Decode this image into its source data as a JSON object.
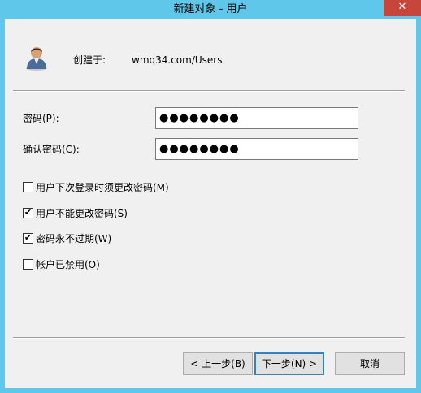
{
  "window": {
    "title": "新建对象 - 用户",
    "close_glyph": "✕"
  },
  "header": {
    "icon": "user-icon",
    "created_in_label": "创建于:",
    "created_in_value": "wmq34.com/Users"
  },
  "fields": {
    "password_label": "密码(P):",
    "password_value": "●●●●●●●●",
    "confirm_label": "确认密码(C):",
    "confirm_value": "●●●●●●●●"
  },
  "options": [
    {
      "label": "用户下次登录时须更改密码(M)",
      "checked": false,
      "mark": ""
    },
    {
      "label": "用户不能更改密码(S)",
      "checked": true,
      "mark": "✔"
    },
    {
      "label": "密码永不过期(W)",
      "checked": true,
      "mark": "✔"
    },
    {
      "label": "帐户已禁用(O)",
      "checked": false,
      "mark": ""
    }
  ],
  "buttons": {
    "back": "< 上一步(B)",
    "next": "下一步(N) >",
    "cancel": "取消"
  },
  "colors": {
    "title_bar": "#5ec7ea",
    "close_button": "#c7463c",
    "dialog_background": "#f0f0f0"
  }
}
